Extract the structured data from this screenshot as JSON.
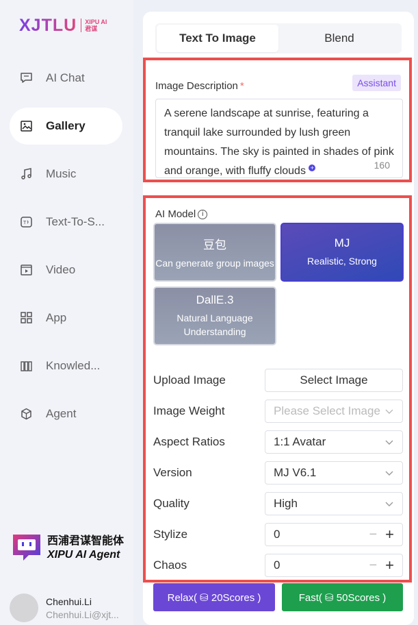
{
  "logo": {
    "main": "XJTLU",
    "sub_line1": "XIPU AI",
    "sub_line2": "君谋"
  },
  "nav": [
    {
      "label": "AI Chat",
      "icon": "chat-icon"
    },
    {
      "label": "Gallery",
      "icon": "gallery-icon",
      "active": true
    },
    {
      "label": "Music",
      "icon": "music-icon"
    },
    {
      "label": "Text-To-S...",
      "icon": "text-to-speech-icon"
    },
    {
      "label": "Video",
      "icon": "video-icon"
    },
    {
      "label": "App",
      "icon": "app-grid-icon"
    },
    {
      "label": "Knowled...",
      "icon": "knowledge-icon"
    },
    {
      "label": "Agent",
      "icon": "agent-cube-icon"
    }
  ],
  "brand": {
    "cn": "西浦君谋智能体",
    "en": "XIPU AI Agent"
  },
  "user": {
    "name": "Chenhui.Li",
    "email": "Chenhui.Li@xjt..."
  },
  "tabs": [
    {
      "label": "Text To Image",
      "active": true
    },
    {
      "label": "Blend",
      "active": false
    }
  ],
  "description": {
    "label": "Image Description",
    "required_mark": "*",
    "assistant_label": "Assistant",
    "text": "A serene landscape at sunrise, featuring a tranquil lake surrounded by lush green mountains. The sky is painted in shades of pink and orange, with fluffy clouds",
    "count": "160"
  },
  "model": {
    "label": "AI Model",
    "options": [
      {
        "title": "豆包",
        "subtitle": "Can generate group images",
        "selected": false
      },
      {
        "title": "MJ",
        "subtitle": "Realistic, Strong",
        "selected": true
      },
      {
        "title": "DallE.3",
        "subtitle": "Natural Language Understanding",
        "selected": false
      }
    ]
  },
  "settings": {
    "upload_label": "Upload Image",
    "upload_button": "Select Image",
    "weight_label": "Image Weight",
    "weight_placeholder": "Please Select Image",
    "aspect_label": "Aspect Ratios",
    "aspect_value": "1:1 Avatar",
    "version_label": "Version",
    "version_value": "MJ V6.1",
    "quality_label": "Quality",
    "quality_value": "High",
    "stylize_label": "Stylize",
    "stylize_value": "0",
    "chaos_label": "Chaos",
    "chaos_value": "0"
  },
  "actions": {
    "relax_label": "Relax( ⛁ 20Scores )",
    "fast_label": "Fast( ⛁ 50Scores )"
  },
  "colors": {
    "accent_purple": "#6b47d6",
    "accent_green": "#1e9f4e",
    "highlight_red": "#ec4f4f"
  }
}
